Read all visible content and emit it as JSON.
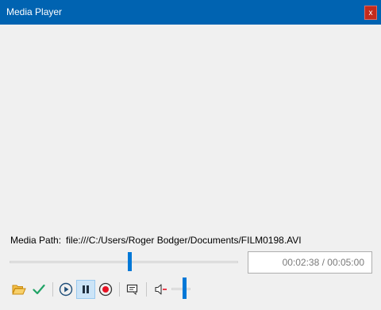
{
  "window": {
    "title": "Media Player",
    "close_label": "x"
  },
  "media": {
    "path_label": "Media Path:",
    "path_value": "file:///C:/Users/Roger Bodger/Documents/FILM0198.AVI",
    "time_display": "00:02:38 / 00:05:00",
    "seek_fraction": 0.527,
    "volume_fraction": 0.75
  },
  "toolbar": {
    "buttons": [
      {
        "icon": "folder-open-icon",
        "pressed": false
      },
      {
        "icon": "checkmark-icon",
        "pressed": false
      },
      {
        "icon": "play-icon",
        "pressed": false
      },
      {
        "icon": "pause-icon",
        "pressed": true
      },
      {
        "icon": "stop-icon",
        "pressed": false
      },
      {
        "icon": "subtitles-icon",
        "pressed": false
      },
      {
        "icon": "volume-icon",
        "pressed": false
      }
    ]
  },
  "colors": {
    "titlebar": "#0063b1",
    "close": "#c42b1c",
    "accent": "#0078d7",
    "folder": "#e8a317",
    "check": "#21a366",
    "stop": "#e81123"
  }
}
